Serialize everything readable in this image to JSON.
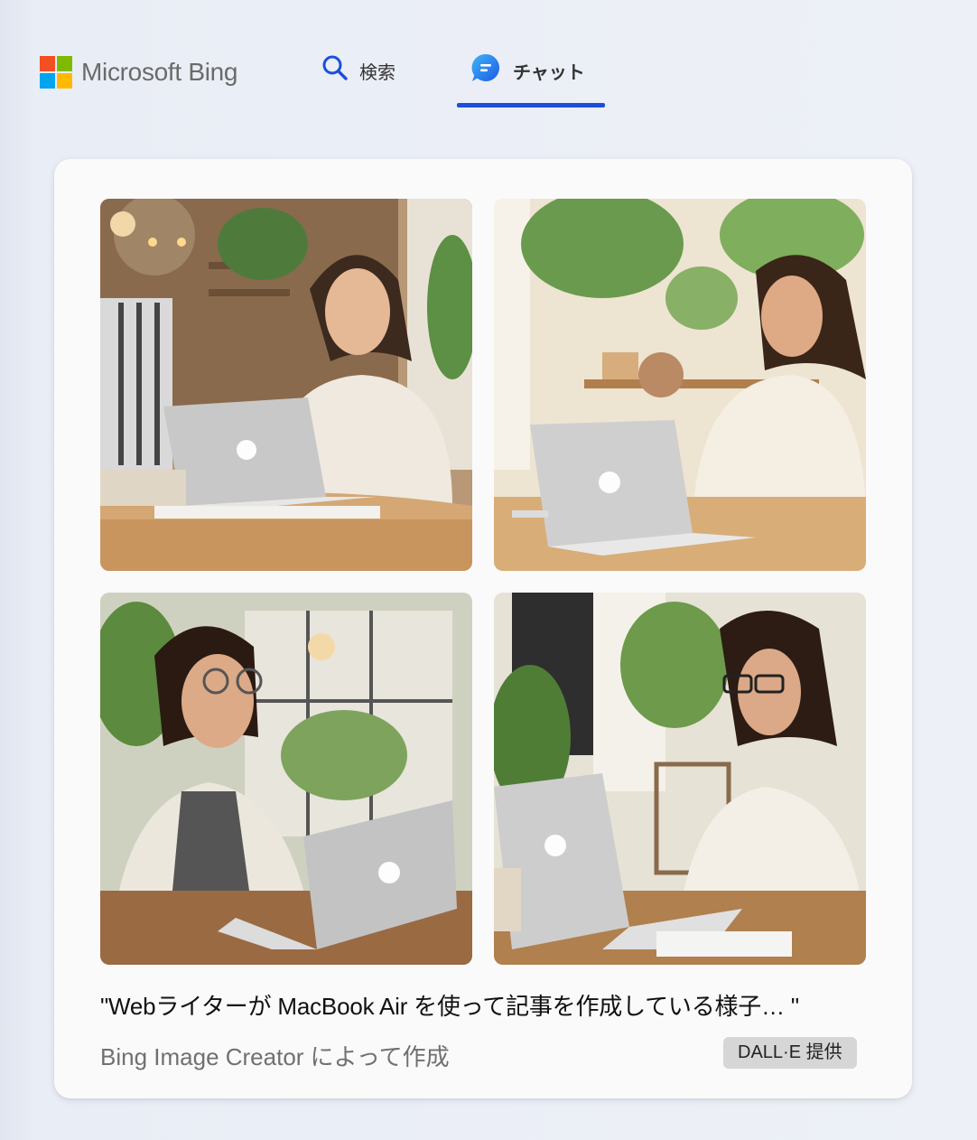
{
  "header": {
    "brand": "Microsoft Bing",
    "logo_colors": [
      "#f25022",
      "#7fba00",
      "#00a4ef",
      "#ffb900"
    ],
    "tabs": [
      {
        "label": "検索",
        "icon": "search-icon",
        "active": false
      },
      {
        "label": "チャット",
        "icon": "chat-icon",
        "active": true
      }
    ],
    "accent_color": "#1a4fde"
  },
  "card": {
    "caption": "\"Webライターが MacBook Air を使って記事を作成している様子… \"",
    "creator": "Bing Image Creator によって作成",
    "badge": "DALL·E 提供",
    "images": [
      {
        "icon": "generated-image"
      },
      {
        "icon": "generated-image"
      },
      {
        "icon": "generated-image"
      },
      {
        "icon": "generated-image"
      }
    ]
  }
}
